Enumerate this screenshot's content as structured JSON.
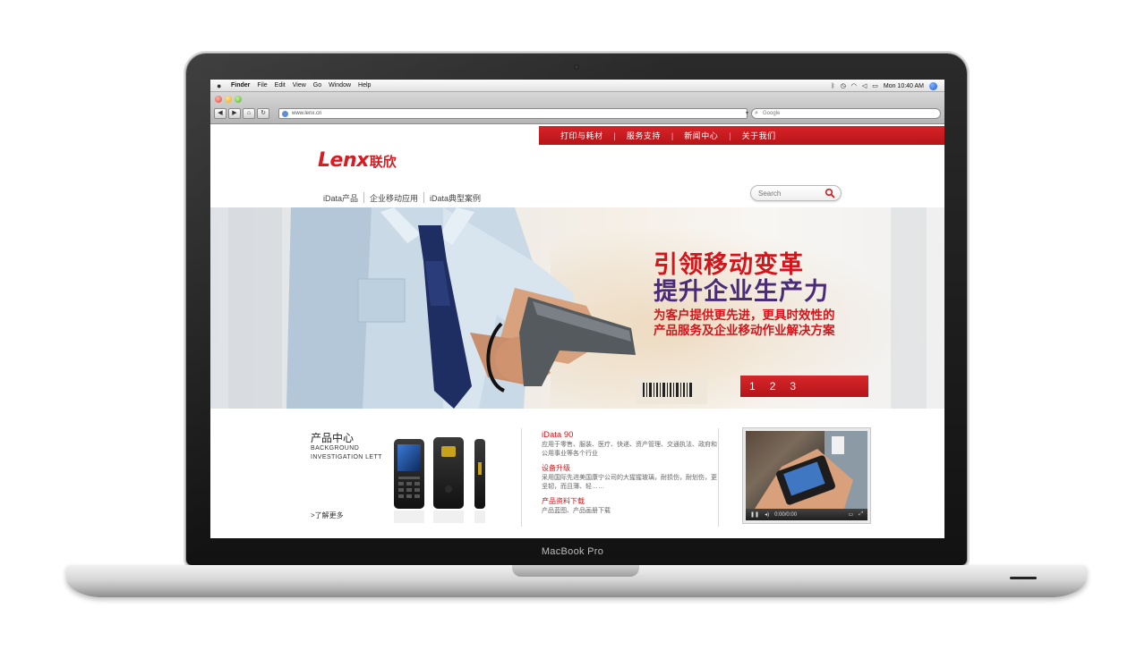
{
  "device": {
    "brand_label": "MacBook Pro"
  },
  "mac_menubar": {
    "items": [
      "Finder",
      "File",
      "Edit",
      "View",
      "Go",
      "Window",
      "Help"
    ],
    "clock": "Mon 10:40 AM"
  },
  "browser": {
    "back": "◀",
    "forward": "▶",
    "home": "⌂",
    "reload": "↻",
    "url": "www.lenx.cn",
    "search_placeholder": "Google"
  },
  "site": {
    "top_nav": [
      "打印与耗材",
      "服务支持",
      "新闻中心",
      "关于我们"
    ],
    "logo_en": "Lenx",
    "logo_cn": "联欣",
    "main_nav": [
      "iData产品",
      "企业移动应用",
      "iData典型案例"
    ],
    "search_placeholder": "Search"
  },
  "hero": {
    "line1": "引领移动变革",
    "line2": "提升企业生产力",
    "line3": "为客户提供更先进，更具时效性的",
    "line4": "产品服务及企业移动作业解决方案",
    "slides": [
      "1",
      "2",
      "3"
    ]
  },
  "product_center": {
    "title": "产品中心",
    "subtitle": "BACKGROUND INVESTIGATION LETT",
    "more": ">了解更多"
  },
  "info": {
    "title": "iData 90",
    "title_text": "应用于零售、服装、医疗、快递、资产管理、交通执法、政府和公用事业等各个行业",
    "upgrade_title": "设备升级",
    "upgrade_text": "采用国际先进美国康宁公司的大猩猩玻璃，耐损伤，耐划伤，更坚韧，而且薄、轻……",
    "download_title": "产品资料下载",
    "download_text": "产品蓝图、产品画册下载"
  },
  "video": {
    "time": "0:00/0:00"
  },
  "colors": {
    "brand_red": "#d51d22",
    "hero_purple": "#4a2a7a"
  }
}
